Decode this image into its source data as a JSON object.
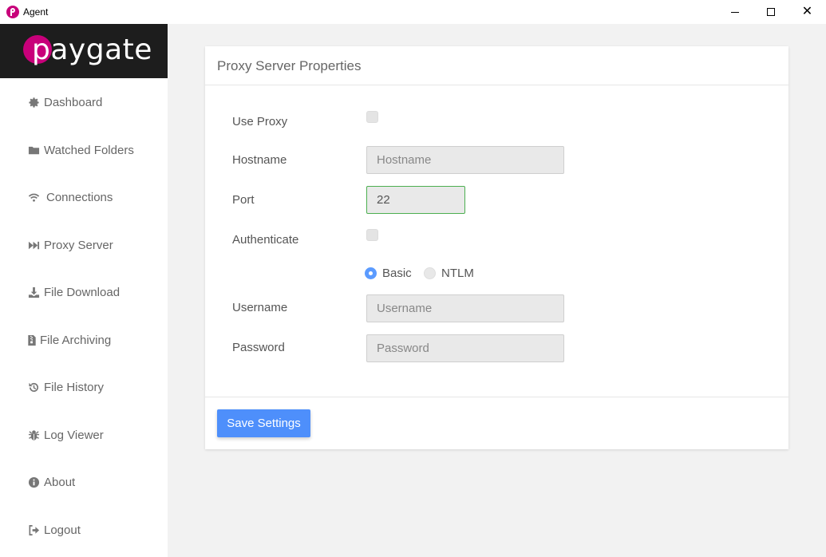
{
  "window": {
    "title": "Agent",
    "close_glyph": "✕"
  },
  "brand": {
    "logo_text": "paygate",
    "accent_color": "#c8007a"
  },
  "sidebar": {
    "items": [
      {
        "label": "Dashboard",
        "icon": "gear-icon"
      },
      {
        "label": "Watched Folders",
        "icon": "folder-icon"
      },
      {
        "label": "Connections",
        "icon": "wifi-icon"
      },
      {
        "label": "Proxy Server",
        "icon": "fast-forward-icon"
      },
      {
        "label": "File Download",
        "icon": "download-icon"
      },
      {
        "label": "File Archiving",
        "icon": "archive-file-icon"
      },
      {
        "label": "File History",
        "icon": "history-icon"
      },
      {
        "label": "Log Viewer",
        "icon": "bug-icon"
      },
      {
        "label": "About",
        "icon": "info-icon"
      },
      {
        "label": "Logout",
        "icon": "logout-icon"
      }
    ]
  },
  "form": {
    "title": "Proxy Server Properties",
    "use_proxy_label": "Use Proxy",
    "use_proxy_checked": false,
    "hostname_label": "Hostname",
    "hostname_placeholder": "Hostname",
    "hostname_value": "",
    "port_label": "Port",
    "port_value": "22",
    "authenticate_label": "Authenticate",
    "authenticate_checked": false,
    "auth_options": [
      "Basic",
      "NTLM"
    ],
    "auth_selected": "Basic",
    "username_label": "Username",
    "username_placeholder": "Username",
    "password_label": "Password",
    "password_placeholder": "Password",
    "save_label": "Save Settings",
    "button_color": "#4e8ffb"
  }
}
